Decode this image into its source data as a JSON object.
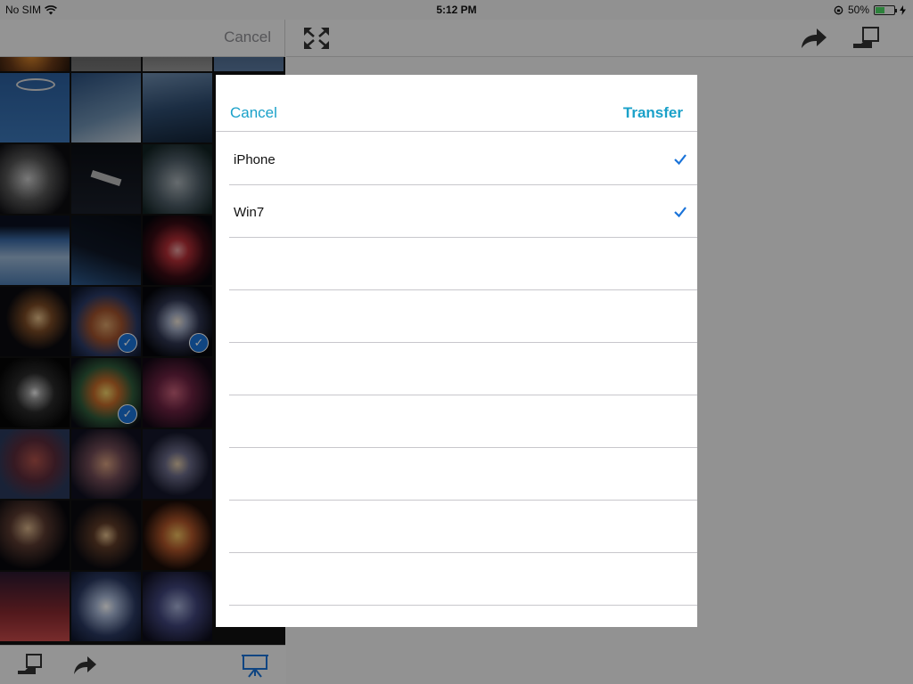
{
  "status_bar": {
    "carrier": "No SIM",
    "time": "5:12 PM",
    "battery_percent": "50%",
    "battery_level": 0.5
  },
  "left_panel": {
    "cancel_label": "Cancel",
    "selected_thumbnail_count": 3
  },
  "popover": {
    "cancel_label": "Cancel",
    "transfer_label": "Transfer",
    "devices": [
      {
        "name": "iPhone",
        "checked": true
      },
      {
        "name": "Win7",
        "checked": true
      }
    ],
    "empty_rows": 7
  },
  "colors": {
    "accent": "#1aa1c9",
    "checkmark": "#1a73d9",
    "separator": "#c8c7cc"
  },
  "icons": {
    "fullscreen": "fullscreen-icon",
    "share": "share-icon",
    "send_to_device": "send-to-device-icon",
    "slideshow": "slideshow-icon"
  }
}
